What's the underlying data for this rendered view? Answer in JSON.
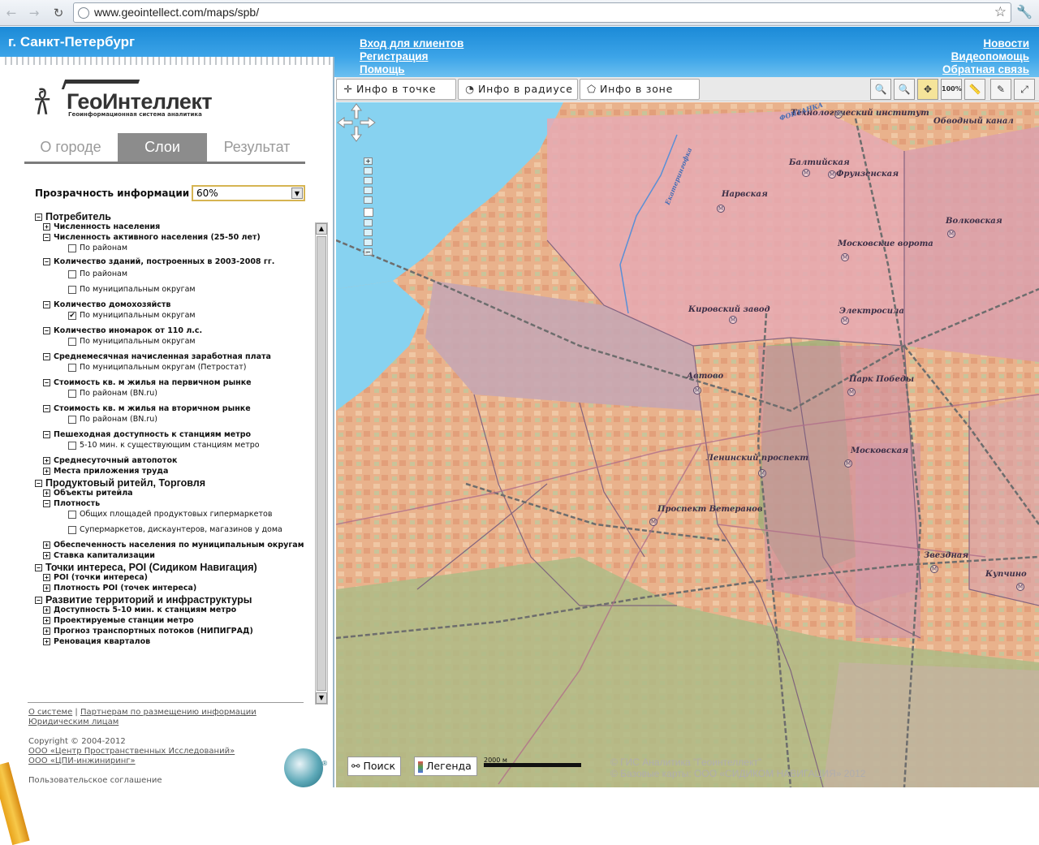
{
  "browser": {
    "url": "www.geointellect.com/maps/spb/",
    "icons": [
      "back-arrow-icon",
      "forward-arrow-icon",
      "reload-icon",
      "globe-icon",
      "star-icon",
      "wrench-icon"
    ]
  },
  "header": {
    "city": "г. Санкт-Петербург",
    "links_left": [
      "Вход для клиентов",
      "Регистрация",
      "Помощь"
    ],
    "links_right": [
      "Новости",
      "Видеопомощь",
      "Обратная связь"
    ]
  },
  "logo": {
    "name": "ГеоИнтеллект",
    "subtitle": "Геоинформационная система аналитика"
  },
  "tabs": [
    {
      "label": "О городе",
      "active": false
    },
    {
      "label": "Слои",
      "active": true
    },
    {
      "label": "Результат",
      "active": false
    }
  ],
  "opacity": {
    "label": "Прозрачность информации",
    "value": "60%"
  },
  "tree": [
    {
      "level": 0,
      "pm": "−",
      "label": "Потребитель"
    },
    {
      "level": 1,
      "pm": "+",
      "label": "Численность населения"
    },
    {
      "level": 1,
      "pm": "−",
      "label": "Численность активного населения (25-50 лет)"
    },
    {
      "level": 2,
      "checked": false,
      "label": "По районам"
    },
    {
      "level": 1,
      "pm": "−",
      "label": "Количество зданий, построенных в 2003-2008 гг."
    },
    {
      "level": 2,
      "checked": false,
      "label": "По районам"
    },
    {
      "level": 2,
      "checked": false,
      "label": "По муниципальным округам"
    },
    {
      "level": 1,
      "pm": "−",
      "label": "Количество домохозяйств"
    },
    {
      "level": 2,
      "checked": true,
      "label": "По муниципальным округам"
    },
    {
      "level": 1,
      "pm": "−",
      "label": "Количество иномарок от 110 л.с."
    },
    {
      "level": 2,
      "checked": false,
      "label": "По муниципальным округам"
    },
    {
      "level": 1,
      "pm": "−",
      "label": "Среднемесячная начисленная заработная плата"
    },
    {
      "level": 2,
      "checked": false,
      "label": "По муниципальным округам (Петростат)"
    },
    {
      "level": 1,
      "pm": "−",
      "label": "Стоимость кв. м жилья на первичном рынке"
    },
    {
      "level": 2,
      "checked": false,
      "label": "По районам (BN.ru)"
    },
    {
      "level": 1,
      "pm": "−",
      "label": "Стоимость кв. м жилья на вторичном рынке"
    },
    {
      "level": 2,
      "checked": false,
      "label": "По районам (BN.ru)"
    },
    {
      "level": 1,
      "pm": "−",
      "label": "Пешеходная доступность к станциям метро"
    },
    {
      "level": 2,
      "checked": false,
      "label": "5-10 мин. к существующим станциям метро"
    },
    {
      "level": 1,
      "pm": "+",
      "label": "Среднесуточный автопоток"
    },
    {
      "level": 1,
      "pm": "+",
      "label": "Места приложения труда"
    },
    {
      "level": 0,
      "pm": "−",
      "label": "Продуктовый ритейл, Торговля"
    },
    {
      "level": 1,
      "pm": "+",
      "label": "Объекты ритейла"
    },
    {
      "level": 1,
      "pm": "−",
      "label": "Плотность"
    },
    {
      "level": 2,
      "checked": false,
      "label": "Общих площадей продуктовых гипермаркетов"
    },
    {
      "level": 2,
      "checked": false,
      "label": "Супермаркетов, дискаунтеров, магазинов у дома"
    },
    {
      "level": 1,
      "pm": "+",
      "label": "Обеспеченность населения по муниципальным округам"
    },
    {
      "level": 1,
      "pm": "+",
      "label": "Ставка капитализации"
    },
    {
      "level": 0,
      "pm": "−",
      "label": "Точки интереса, POI (Сидиком Навигация)"
    },
    {
      "level": 1,
      "pm": "+",
      "label": "POI (точки интереса)"
    },
    {
      "level": 1,
      "pm": "+",
      "label": "Плотность POI (точек интереса)"
    },
    {
      "level": 0,
      "pm": "−",
      "label": "Развитие территорий и инфраструктуры"
    },
    {
      "level": 1,
      "pm": "+",
      "label": "Доступность 5-10 мин. к станциям метро"
    },
    {
      "level": 1,
      "pm": "+",
      "label": "Проектируемые станции метро"
    },
    {
      "level": 1,
      "pm": "+",
      "label": "Прогноз транспортных потоков (НИПИГРАД)"
    },
    {
      "level": 1,
      "pm": "+",
      "label": "Реновация кварталов"
    }
  ],
  "footer": {
    "link1": "О системе",
    "sep": "|",
    "link2": "Партнерам по размещению информации",
    "link3": "Юридическим лицам",
    "copyright": "Copyright © 2004-2012",
    "org1": "ООО «Центр Пространственных Исследований»",
    "org2": "ООО «ЦПИ-инжиниринг»",
    "agreement": "Пользовательское соглашение",
    "registered": "®"
  },
  "map_tools": [
    {
      "label": "Инфо в точке",
      "icon": "crosshair-icon"
    },
    {
      "label": "Инфо в радиусе",
      "icon": "radius-icon"
    },
    {
      "label": "Инфо в зоне",
      "icon": "polygon-zone-icon"
    }
  ],
  "map_icons": [
    {
      "name": "zoom-in-icon",
      "glyph": "🔍"
    },
    {
      "name": "zoom-out-icon",
      "glyph": "🔍"
    },
    {
      "name": "pan-icon",
      "glyph": "✥"
    },
    {
      "name": "zoom-100-icon",
      "glyph": "100%"
    },
    {
      "name": "ruler-icon",
      "glyph": "📏"
    },
    {
      "name": "eraser-icon",
      "glyph": "✎"
    },
    {
      "name": "fullscreen-icon",
      "glyph": "⤢"
    }
  ],
  "map": {
    "labels": [
      "Технологический институт",
      "Обводный канал",
      "Балтийская",
      "Фрунзенская",
      "Нарвская",
      "Волковская",
      "Московские ворота",
      "Кировский завод",
      "Электросила",
      "Автово",
      "Парк Победы",
      "Московская",
      "Ленинский проспект",
      "Проспект Ветеранов",
      "Звездная",
      "Купчино",
      "Екатерингофка",
      "ФОНТАНКА"
    ],
    "metro_glyph": "М",
    "search_label": "Поиск",
    "legend_label": "Легенда",
    "scale_text": "2000 м",
    "copyright1": "© ГИС Аналитика \"Геоинтеллект\"",
    "copyright2": "© Базовые карты: ООО «СИДИКОМ НАВИГАЦИЯ» 2012"
  }
}
